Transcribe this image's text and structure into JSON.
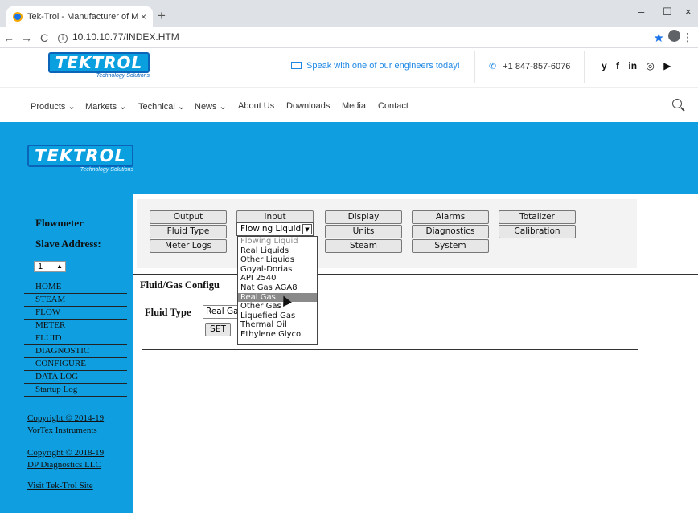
{
  "browser": {
    "tab_title": "Tek-Trol - Manufacturer of Meas",
    "tab_close": "×",
    "new_tab": "+",
    "minimize": "–",
    "maximize": "☐",
    "close": "×",
    "url": "10.10.10.77/INDEX.HTM",
    "back": "←",
    "forward": "→",
    "reload": "C"
  },
  "site": {
    "logo_text": "TEKTROL",
    "logo_sub": "Technology Solutions",
    "contact_text": "Speak with one of our engineers today!",
    "phone": "+1 847-857-6076",
    "social": [
      "y",
      "f",
      "in",
      "◎",
      "▶"
    ],
    "menu": [
      "Products ⌄",
      "Markets ⌄",
      "Technical ⌄",
      "News ⌄",
      "About Us",
      "Downloads",
      "Media",
      "Contact"
    ]
  },
  "sidebar": {
    "title1": "Flowmeter",
    "title2": "Slave Address:",
    "slave_value": "1",
    "links": [
      "HOME",
      "STEAM",
      "FLOW",
      "METER",
      "FLUID",
      "DIAGNOSTIC",
      "CONFIGURE",
      "DATA LOG",
      "Startup Log"
    ],
    "copyright1_line1": "Copyright © 2014-19",
    "copyright1_line2": "VorTex Instruments",
    "copyright2_line1": "Copyright © 2018-19",
    "copyright2_line2": "DP Diagnostics LLC",
    "visit": "Visit Tek-Trol Site"
  },
  "panel": {
    "buttons": {
      "output": "Output",
      "input": "Input",
      "display": "Display",
      "alarms": "Alarms",
      "totalizer": "Totalizer",
      "fluid_type": "Fluid Type",
      "units": "Units",
      "diagnostics": "Diagnostics",
      "calibration": "Calibration",
      "meter_logs": "Meter Logs",
      "steam": "Steam",
      "system": "System"
    },
    "dropdown_selected": "Flowing Liquid",
    "dropdown_options": [
      "Flowing Liquid",
      "Real Liquids",
      "Other Liquids",
      "Goyal-Dorias",
      "API 2540",
      "Nat Gas AGA8",
      "Real Gas",
      "Other Gas",
      "Liquefied Gas",
      "Thermal Oil",
      "Ethylene Glycol"
    ],
    "highlighted_option": "Real Gas",
    "form_title": "Fluid/Gas Configu",
    "fluid_label": "Fluid Type",
    "fluid_value": "Real Ga",
    "set_label": "SET"
  }
}
